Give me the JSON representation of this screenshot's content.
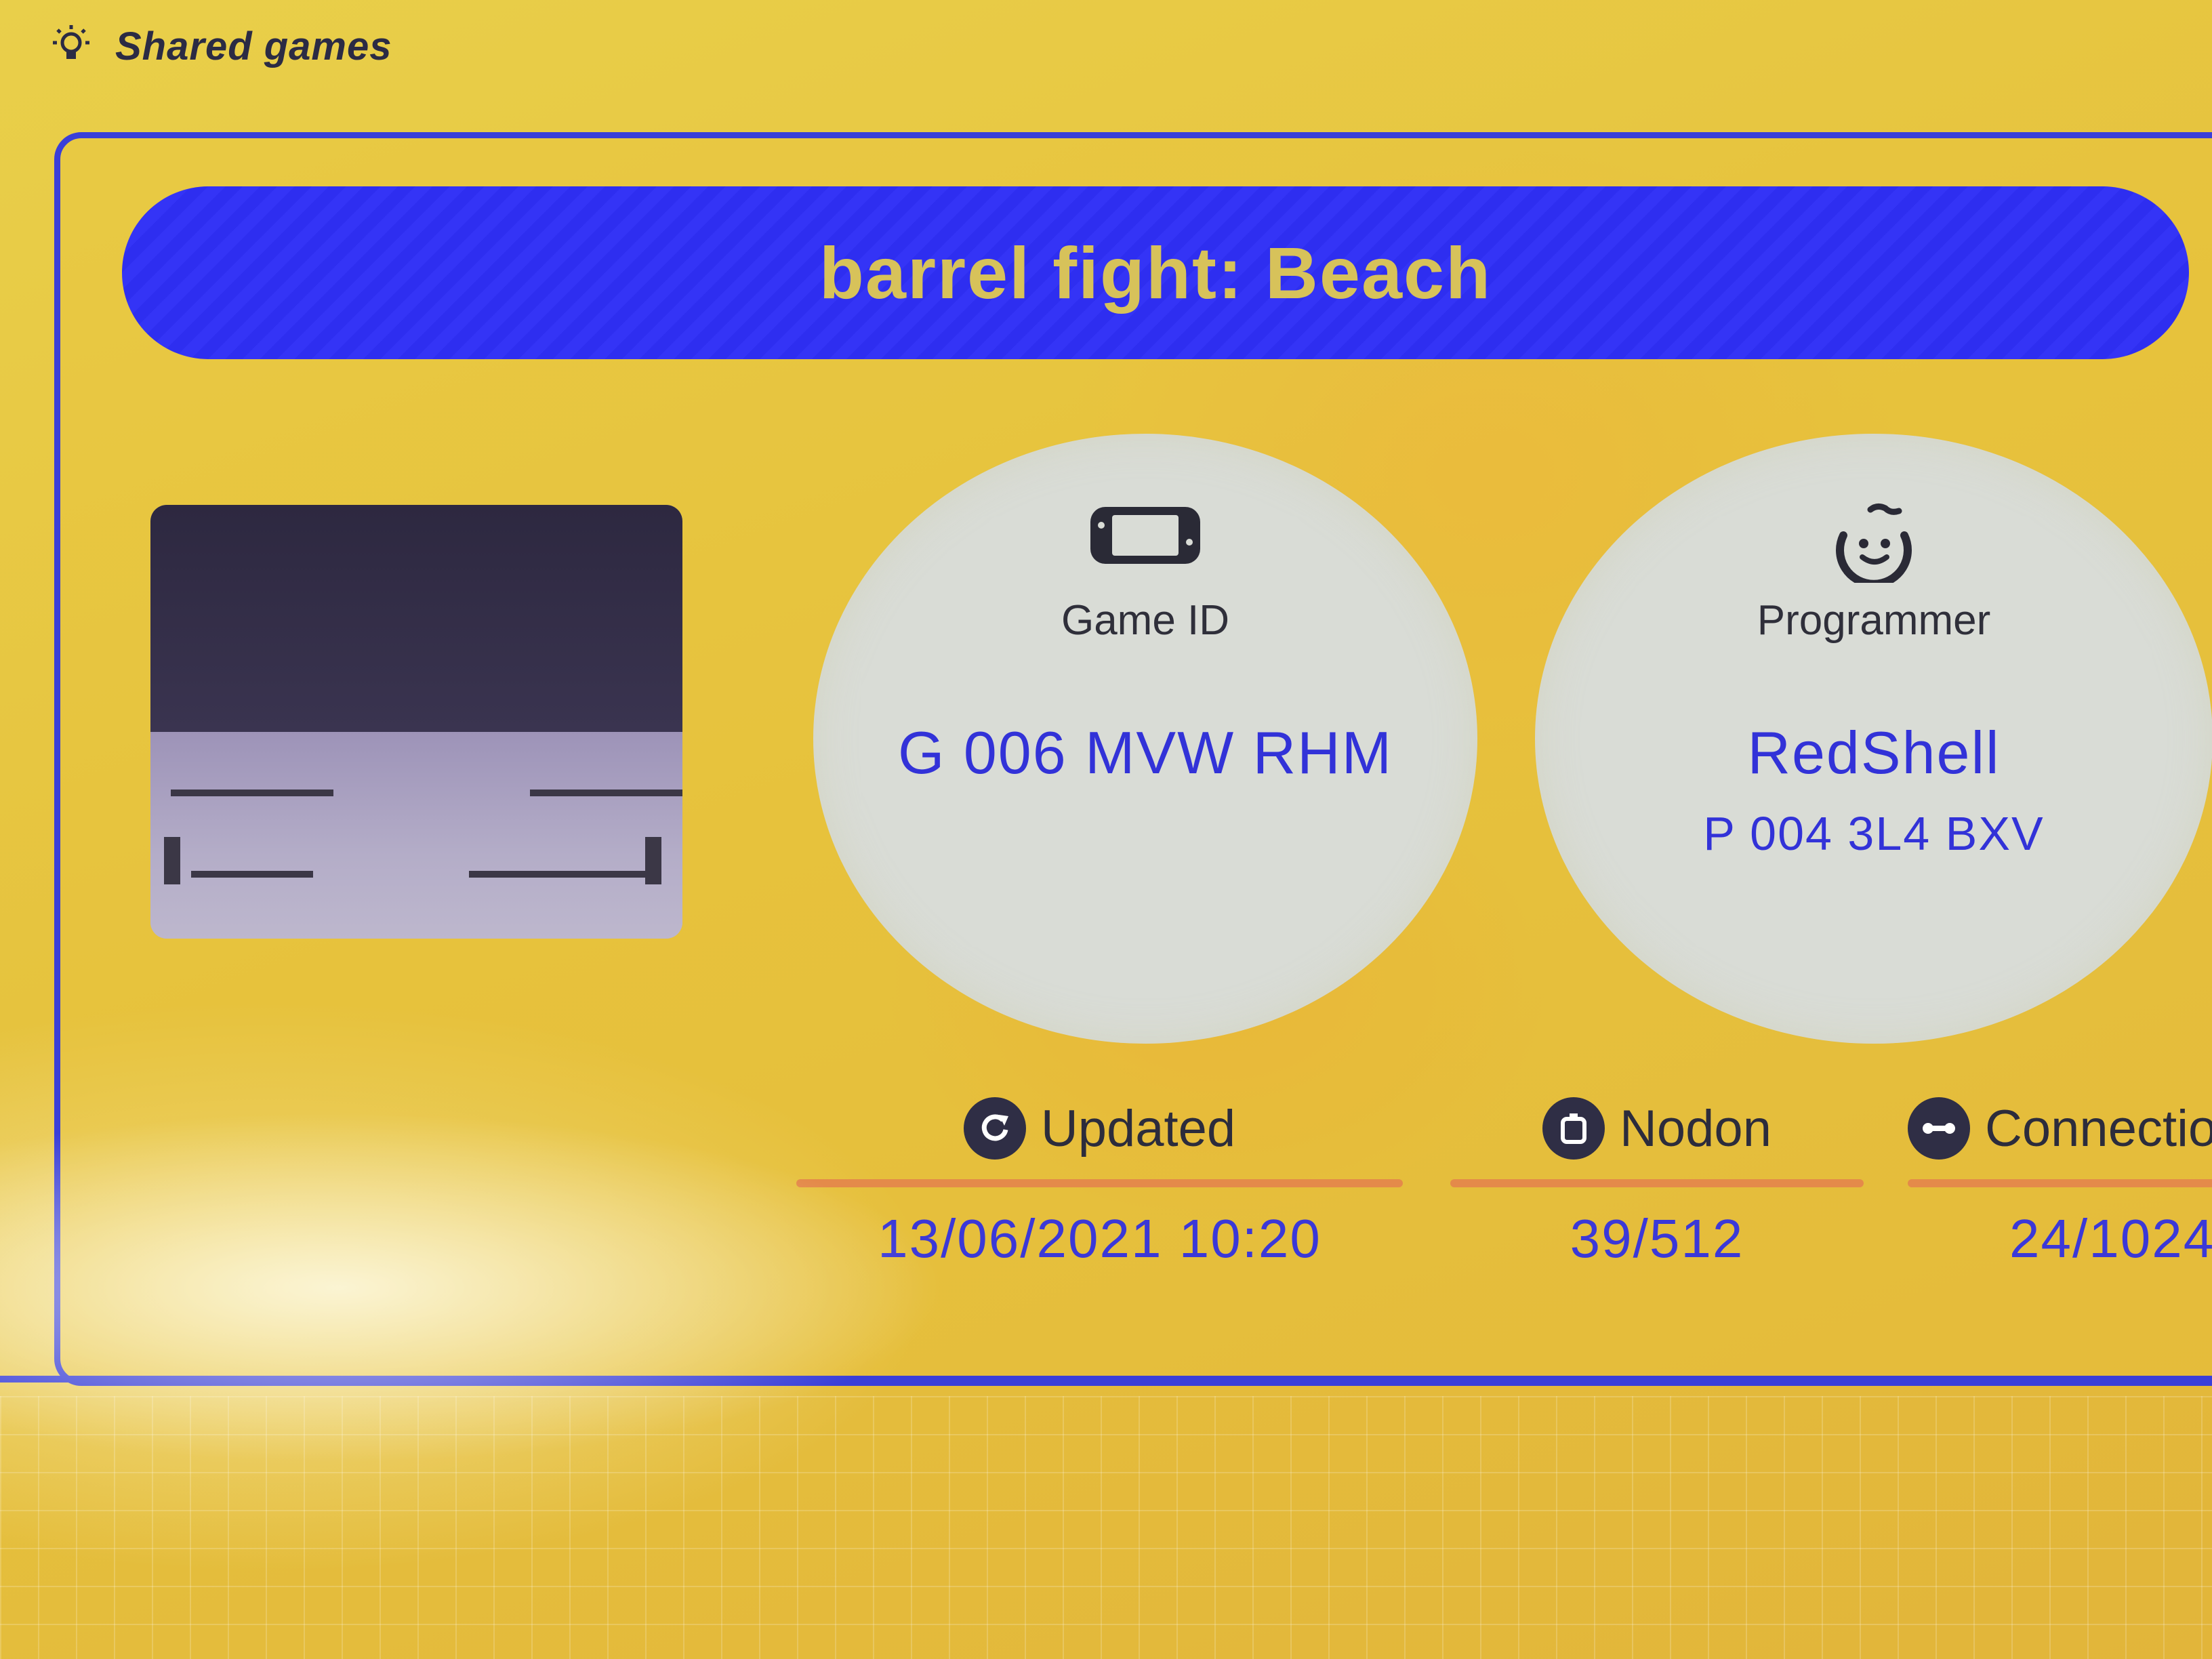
{
  "header": {
    "title": "Shared games",
    "icon": "lightbulb-icon"
  },
  "game": {
    "title": "barrel fight: Beach"
  },
  "game_id": {
    "label": "Game ID",
    "value": "G 006 MVW RHM",
    "icon": "switch-console-icon"
  },
  "programmer": {
    "label": "Programmer",
    "name": "RedShell",
    "id": "P 004 3L4 BXV",
    "icon": "face-icon"
  },
  "stats": {
    "updated": {
      "label": "Updated",
      "value": "13/06/2021 10:20",
      "icon": "refresh-icon"
    },
    "nodon": {
      "label": "Nodon",
      "value": "39/512",
      "icon": "nodon-icon"
    },
    "connections": {
      "label": "Connectio",
      "value": "24/1024",
      "icon": "connection-icon"
    }
  },
  "colors": {
    "background": "#e8c43a",
    "accent_blue": "#3232d8",
    "banner_blue": "#2e2ef0",
    "underline_orange": "#e48a4a",
    "circle_bg": "#d9dcd6"
  }
}
